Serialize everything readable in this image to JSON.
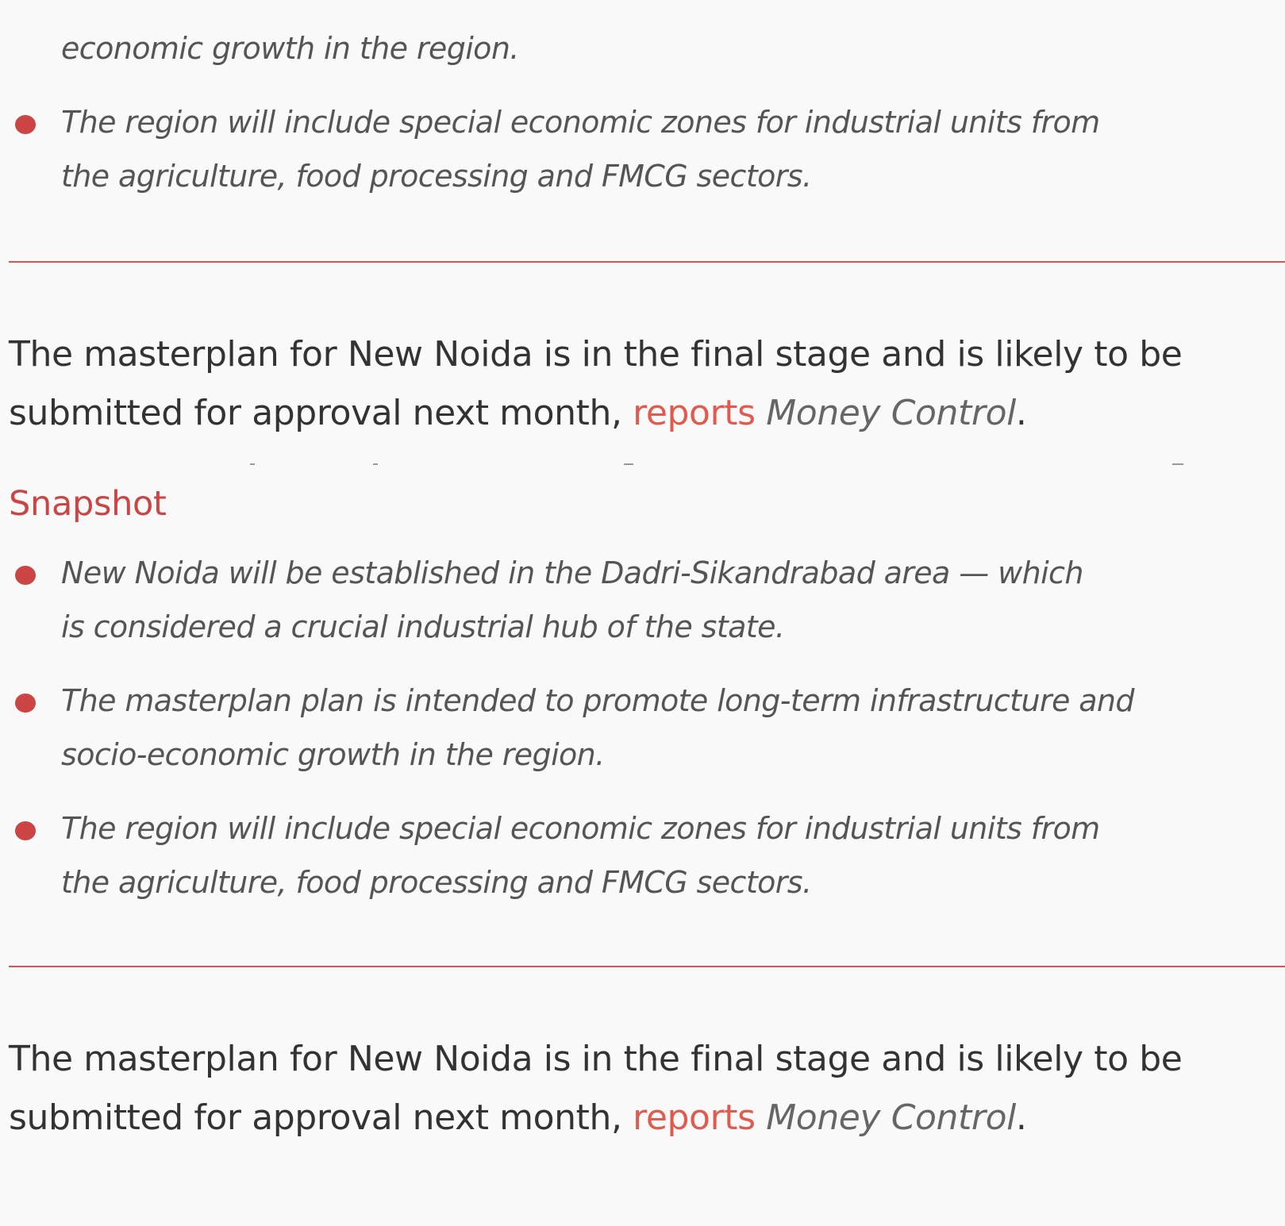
{
  "top_partial_list": {
    "items": [
      "economic growth in the region.",
      "The region will include special economic zones for industrial units from the agriculture, food processing and FMCG sectors."
    ]
  },
  "lead_1": {
    "text": "The masterplan for New Noida is in the final stage and is likely to be submitted for approval next month, ",
    "link_label": "reports",
    "source": "Money Control",
    "end": "."
  },
  "snapshot": {
    "title": "Snapshot",
    "items": [
      "New Noida will be established in the Dadri-Sikandrabad area — which is considered a crucial industrial hub of the state.",
      "The masterplan plan is intended to promote long-term infrastructure and socio-economic growth in the region.",
      "The region will include special economic zones for industrial units from the agriculture, food processing and FMCG sectors."
    ]
  },
  "lead_2": {
    "text": "The masterplan for New Noida is in the final stage and is likely to be submitted for approval next month, ",
    "link_label": "reports",
    "source": "Money Control",
    "end": "."
  },
  "colors": {
    "accent": "#cc4444",
    "link": "#e05a4f",
    "background": "#f9f9f9"
  }
}
